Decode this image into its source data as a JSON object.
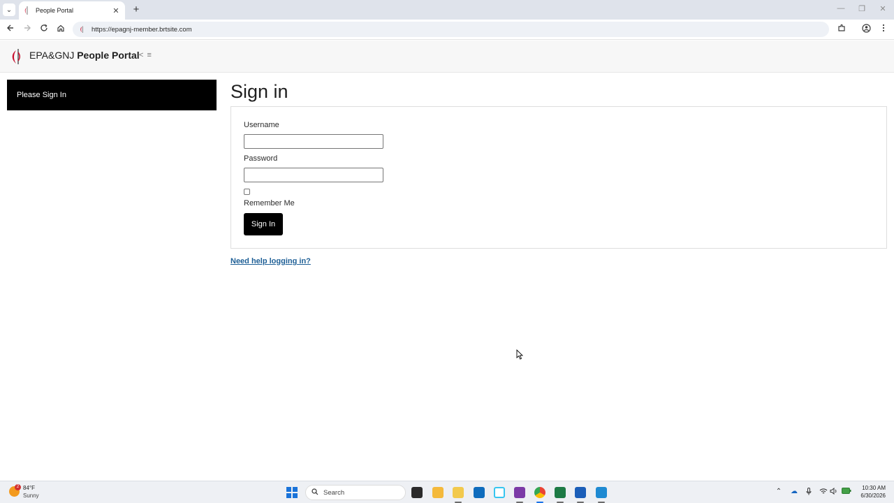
{
  "browser": {
    "tab_title": "People Portal",
    "tab_close": "✕",
    "new_tab": "+",
    "url": "https://epagnj-member.brtsite.com",
    "window_minimize": "—",
    "window_restore": "❐",
    "window_close": "✕"
  },
  "header": {
    "brand_prefix": "EPA&GNJ",
    "brand_name": "People Portal",
    "toggle_label": "< ≡"
  },
  "sidebar": {
    "signin_label": "Please Sign In"
  },
  "main": {
    "title": "Sign in",
    "username_label": "Username",
    "username_value": "",
    "password_label": "Password",
    "password_value": "",
    "remember_label": "Remember Me",
    "remember_checked": false,
    "signin_button": "Sign In",
    "help_link": "Need help logging in?"
  },
  "taskbar": {
    "weather_badge": "2",
    "weather_temp": "84°F",
    "weather_condition": "Sunny",
    "search_placeholder": "Search",
    "time": "10:30 AM",
    "date": "6/30/2026"
  },
  "colors": {
    "accent_black": "#000000",
    "link_blue": "#1e5f96",
    "logo_red": "#c8102e"
  },
  "icons": [
    "tab-list-icon",
    "back-icon",
    "forward-icon",
    "reload-icon",
    "home-icon",
    "site-info-icon",
    "extensions-icon",
    "profile-icon",
    "menu-icon",
    "church-logo-icon"
  ]
}
